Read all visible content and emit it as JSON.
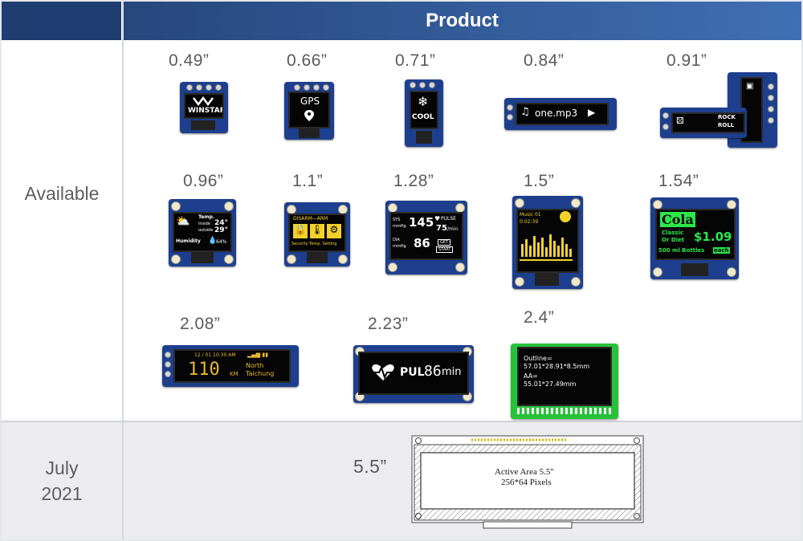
{
  "header": {
    "product": "Product"
  },
  "rows": {
    "available": "Available",
    "july": "July",
    "year": "2021"
  },
  "sizes": {
    "s049": "0.49”",
    "s066": "0.66”",
    "s071": "0.71”",
    "s084": "0.84”",
    "s091": "0.91”",
    "s096": "0.96”",
    "s11": "1.1”",
    "s128": "1.28”",
    "s15": "1.5”",
    "s154": "1.54”",
    "s208": "2.08”",
    "s223": "2.23”",
    "s24": "2.4”",
    "s55": "5.5”"
  },
  "screens": {
    "winstar": "WINSTAR",
    "gps": "GPS",
    "cool": "COOL",
    "one_mp3": "one.mp3",
    "d091a": "ROCK",
    "d091b": "ROLL",
    "temp": "Temp.",
    "inside": "inside",
    "outside": "outside",
    "t_in": "24°",
    "t_out": "29°",
    "humidity": "Humidity",
    "hum_val": "64%",
    "disarm": "DISARM—ARM",
    "security": "Security Temp. Setting",
    "sys": "SYS",
    "mmhg": "mmHg",
    "sys_val": "145",
    "pulse": "PULSE",
    "pulse_val": "75",
    "per_min": "/min",
    "dia": "DIA",
    "dia_val": "86",
    "get": "GET",
    "start": "START",
    "music": "Music 01",
    "music_time": "0:02:39",
    "cola": "Cola",
    "classic": "Classic",
    "or_diet": "Or Diet",
    "price": "$1.09",
    "bottles": "500 ml Bottles",
    "each": "each",
    "time_208": "12 / 01  10:30 AM",
    "big_208": "110",
    "km": "KM",
    "north": "North",
    "taichung": "Taichung",
    "pul": "PUL",
    "pul_val": "86",
    "min": "min",
    "outline_line1": "Outline=",
    "outline_line2": "57.01*28.91*8.5mm",
    "aa_line1": "AA=",
    "aa_line2": "55.01*27.49mm",
    "active_area": "Active Area 5.5\"",
    "pixels": "256*64 Pixels"
  },
  "colors": {
    "header_dark": "#1f3d70",
    "header_gradient_end": "#3f6fb4",
    "pcb_blue": "#1d3f8e",
    "yellow_oled": "#f2d22a",
    "green_oled": "#2ce64a",
    "amber_oled": "#e8b830",
    "green_pcb": "#27c23a"
  }
}
